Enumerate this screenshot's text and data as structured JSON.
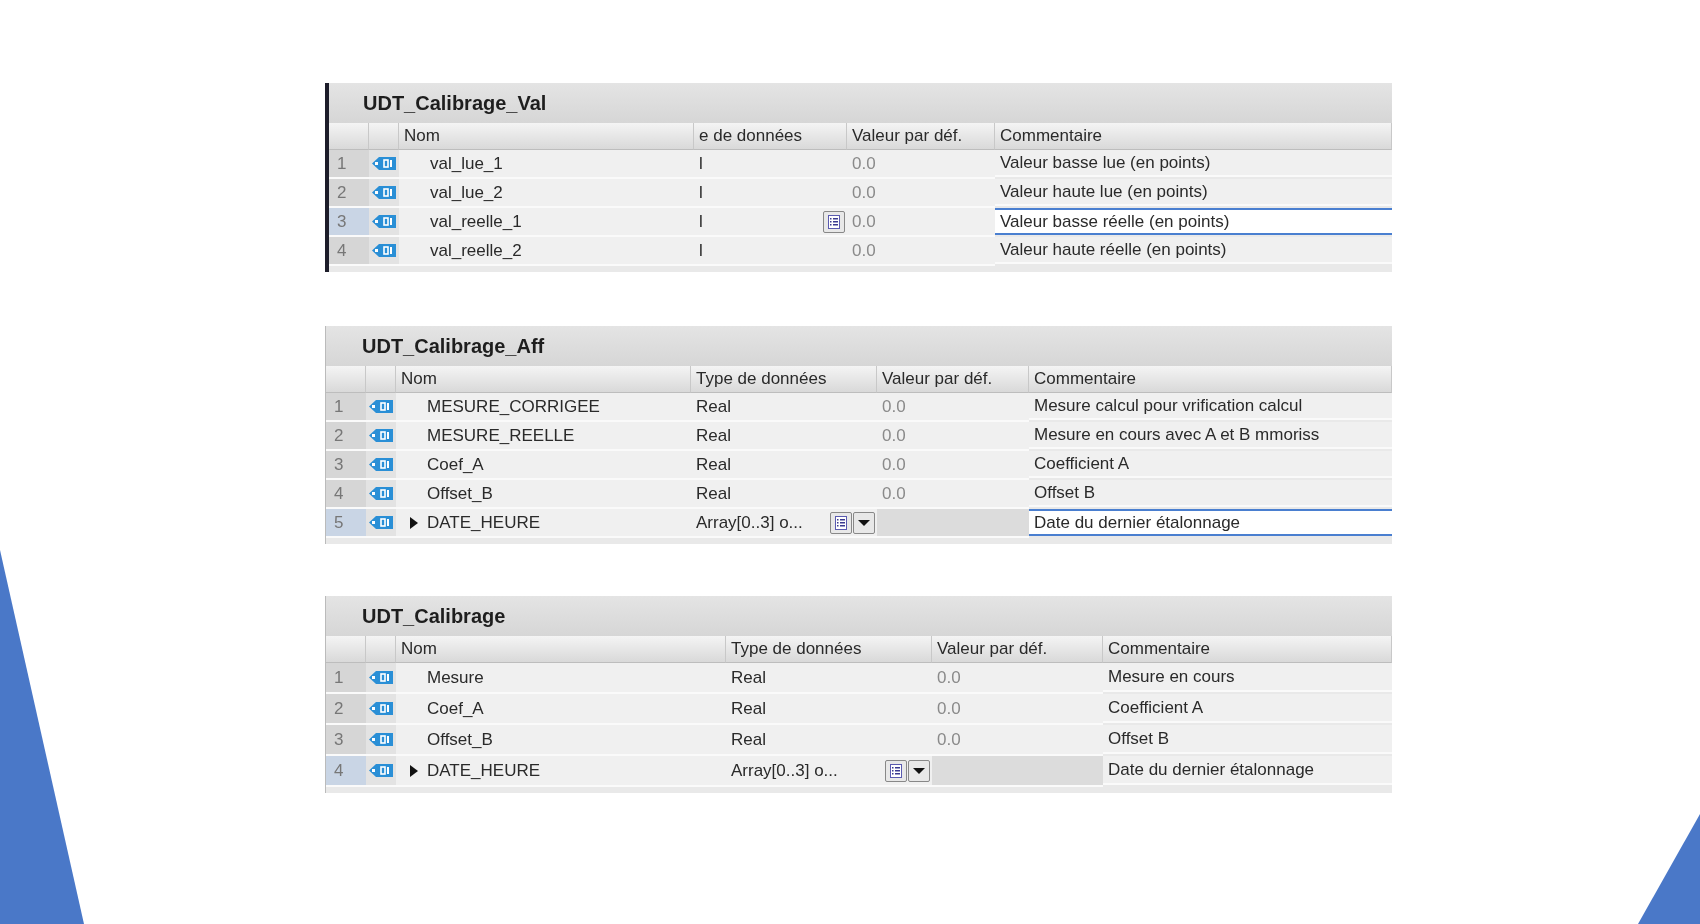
{
  "tables": [
    {
      "title": "UDT_Calibrage_Val",
      "columns": [
        "Nom",
        "e de données",
        "Valeur par déf.",
        "Commentaire"
      ],
      "rows": [
        {
          "number": "1",
          "name": "val_lue_1",
          "expandable": false,
          "type": "l",
          "type_buttons": [],
          "default": "0.0",
          "comment": "Valeur basse lue (en points)",
          "selected": false,
          "editing": false
        },
        {
          "number": "2",
          "name": "val_lue_2",
          "expandable": false,
          "type": "l",
          "type_buttons": [],
          "default": "0.0",
          "comment": "Valeur haute lue (en points)",
          "selected": false,
          "editing": false
        },
        {
          "number": "3",
          "name": "val_reelle_1",
          "expandable": false,
          "type": "l",
          "type_buttons": [
            {
              "kind": "list"
            }
          ],
          "default": "0.0",
          "comment": "Valeur basse réelle (en points)",
          "selected": true,
          "editing": true
        },
        {
          "number": "4",
          "name": "val_reelle_2",
          "expandable": false,
          "type": "l",
          "type_buttons": [],
          "default": "0.0",
          "comment": "Valeur haute réelle (en points)",
          "selected": false,
          "editing": false
        }
      ]
    },
    {
      "title": "UDT_Calibrage_Aff",
      "columns": [
        "Nom",
        "Type de données",
        "Valeur par déf.",
        "Commentaire"
      ],
      "rows": [
        {
          "number": "1",
          "name": "MESURE_CORRIGEE",
          "expandable": false,
          "type": "Real",
          "type_buttons": [],
          "default": "0.0",
          "comment": "Mesure calcul pour vrification calcul",
          "selected": false,
          "editing": false
        },
        {
          "number": "2",
          "name": "MESURE_REELLE",
          "expandable": false,
          "type": "Real",
          "type_buttons": [],
          "default": "0.0",
          "comment": "Mesure en cours avec A et B mmoriss",
          "selected": false,
          "editing": false
        },
        {
          "number": "3",
          "name": "Coef_A",
          "expandable": false,
          "type": "Real",
          "type_buttons": [],
          "default": "0.0",
          "comment": "Coefficient A",
          "selected": false,
          "editing": false
        },
        {
          "number": "4",
          "name": "Offset_B",
          "expandable": false,
          "type": "Real",
          "type_buttons": [],
          "default": "0.0",
          "comment": "Offset B",
          "selected": false,
          "editing": false
        },
        {
          "number": "5",
          "name": "DATE_HEURE",
          "expandable": true,
          "type": "Array[0..3] o...",
          "type_buttons": [
            {
              "kind": "list"
            },
            {
              "kind": "dropdown"
            }
          ],
          "comment": "Date du dernier étalonnage",
          "selected": true,
          "editing": true
        }
      ]
    },
    {
      "title": "UDT_Calibrage",
      "columns": [
        "Nom",
        "Type de données",
        "Valeur par déf.",
        "Commentaire"
      ],
      "rows": [
        {
          "number": "1",
          "name": "Mesure",
          "expandable": false,
          "type": "Real",
          "type_buttons": [],
          "default": "0.0",
          "comment": "Mesure en cours",
          "selected": false,
          "editing": false
        },
        {
          "number": "2",
          "name": "Coef_A",
          "expandable": false,
          "type": "Real",
          "type_buttons": [],
          "default": "0.0",
          "comment": "Coefficient A",
          "selected": false,
          "editing": false
        },
        {
          "number": "3",
          "name": "Offset_B",
          "expandable": false,
          "type": "Real",
          "type_buttons": [],
          "default": "0.0",
          "comment": "Offset B",
          "selected": false,
          "editing": false
        },
        {
          "number": "4",
          "name": "DATE_HEURE",
          "expandable": true,
          "type": "Array[0..3] o...",
          "type_buttons": [
            {
              "kind": "list"
            },
            {
              "kind": "dropdown"
            }
          ],
          "comment": "Date du dernier étalonnage",
          "selected": true,
          "editing": false
        }
      ]
    }
  ]
}
